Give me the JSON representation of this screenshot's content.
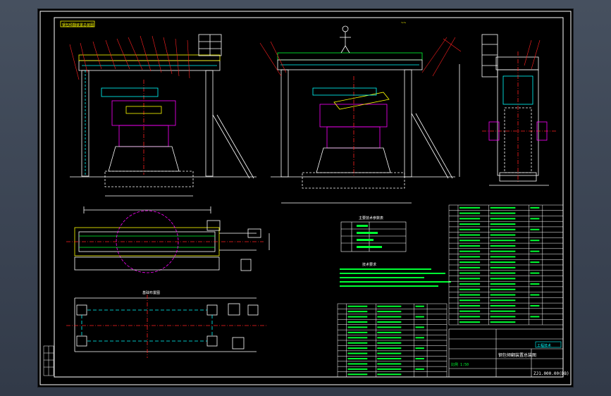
{
  "colors": {
    "background": "#3b4453",
    "sheet": "#000000",
    "line_white": "#ffffff",
    "line_yellow": "#ffff00",
    "line_magenta": "#ff00ff",
    "line_red": "#ff2020",
    "line_green": "#00ff33",
    "line_cyan": "#00ffff"
  },
  "drawing": {
    "stamp_top_left": "钢包倾翻装置总装图",
    "dimension_marks": "~~",
    "title_block_name": "钢包倾翻装置总装图",
    "drawing_number": "ZJ1.000.00(DB)",
    "scale_label": "比例 1:50",
    "company_label": "工程技术"
  },
  "table_top": {
    "title": "主要技术参数表"
  },
  "notes": {
    "title": "技术要求"
  },
  "parts_lists": {
    "right_rows": 22,
    "lower_rows": 14
  }
}
